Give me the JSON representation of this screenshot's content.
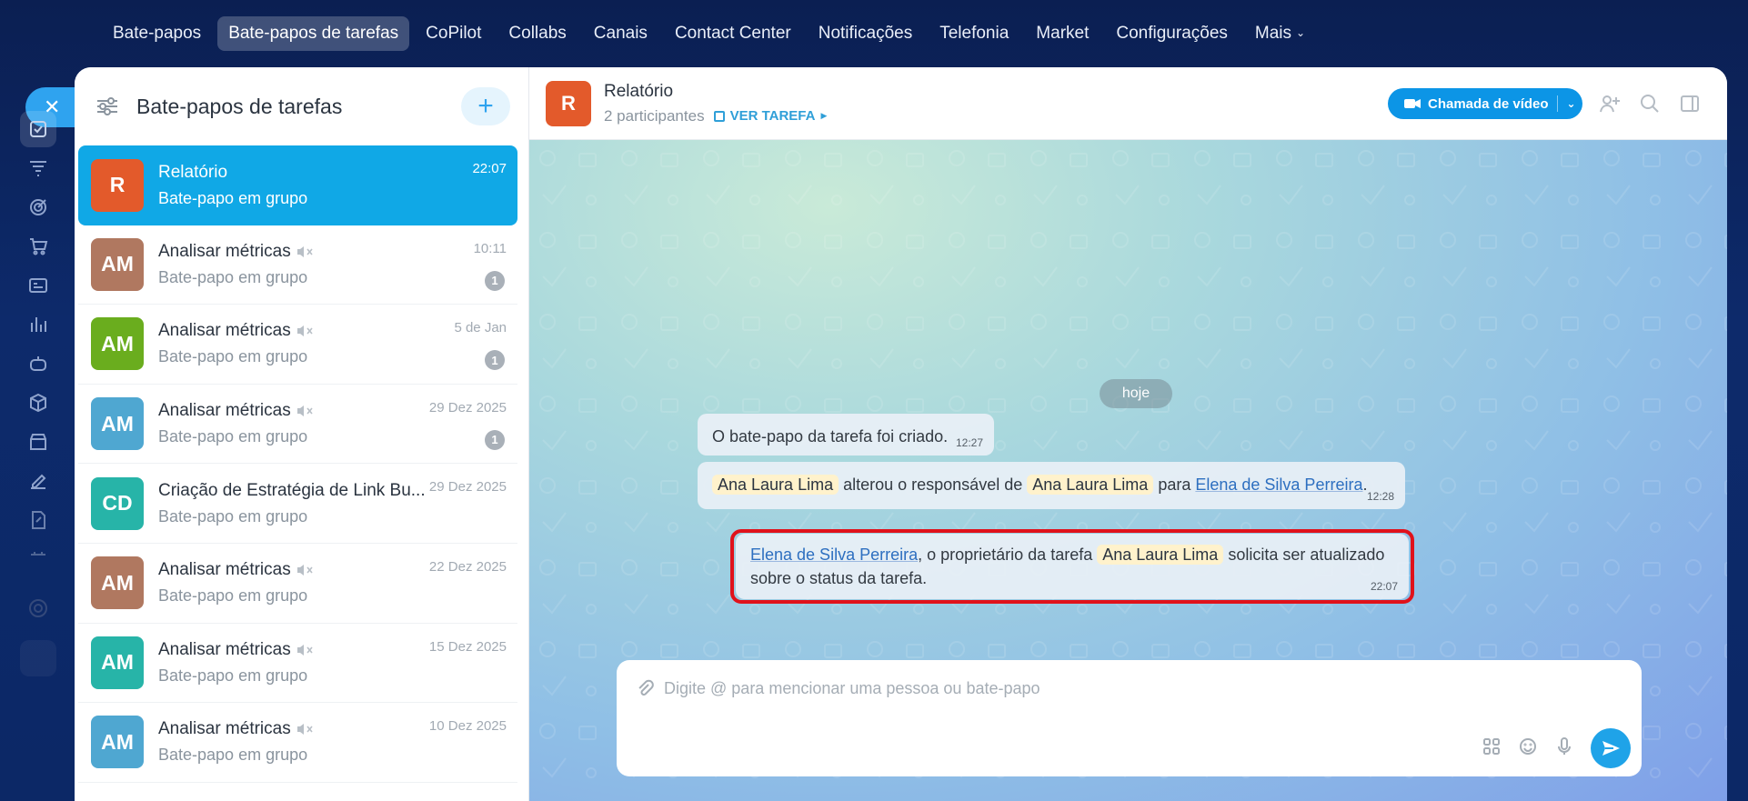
{
  "topnav": {
    "items": [
      "Bate-papos",
      "Bate-papos de tarefas",
      "CoPilot",
      "Collabs",
      "Canais",
      "Contact Center",
      "Notificações",
      "Telefonia",
      "Market",
      "Configurações",
      "Mais"
    ],
    "active_index": 1
  },
  "sidebar": {
    "title": "Bate-papos de tarefas",
    "add_label": "+",
    "chats": [
      {
        "initials": "R",
        "title": "Relatório",
        "sub": "Bate-papo em grupo",
        "time": "22:07",
        "color": "#e35a2b"
      },
      {
        "initials": "AM",
        "title": "Analisar métricas",
        "sub": "Bate-papo em grupo",
        "time": "10:11",
        "badge": "1",
        "color": "#b07860"
      },
      {
        "initials": "AM",
        "title": "Analisar métricas",
        "sub": "Bate-papo em grupo",
        "time": "5 de Jan",
        "badge": "1",
        "color": "#6aad1e"
      },
      {
        "initials": "AM",
        "title": "Analisar métricas",
        "sub": "Bate-papo em grupo",
        "time": "29 Dez 2025",
        "badge": "1",
        "color": "#4fa7d1"
      },
      {
        "initials": "CD",
        "title": "Criação de Estratégia de Link Bu...",
        "sub": "Bate-papo em grupo",
        "time": "29 Dez 2025",
        "color": "#27b4a8"
      },
      {
        "initials": "AM",
        "title": "Analisar métricas",
        "sub": "Bate-papo em grupo",
        "time": "22 Dez 2025",
        "color": "#b07860"
      },
      {
        "initials": "AM",
        "title": "Analisar métricas",
        "sub": "Bate-papo em grupo",
        "time": "15 Dez 2025",
        "color": "#27b4a8"
      },
      {
        "initials": "AM",
        "title": "Analisar métricas",
        "sub": "Bate-papo em grupo",
        "time": "10 Dez 2025",
        "color": "#4fa7d1"
      }
    ]
  },
  "chat": {
    "title": "Relatório",
    "avatar": "R",
    "participants": "2 participantes",
    "task_link": "VER TAREFA",
    "video_call": "Chamada de vídeo",
    "date_separator": "hoje",
    "messages": [
      {
        "text": "O bate-papo da tarefa foi criado.",
        "time": "12:27"
      },
      {
        "name1": "Ana Laura Lima",
        "mid1": " alterou o responsável de ",
        "name2": "Ana Laura Lima",
        "mid2": " para ",
        "name3": "Elena de Silva Perreira",
        "end": ".",
        "time": "12:28"
      },
      {
        "name1": "Elena de Silva Perreira",
        "mid1": ", o proprietário da tarefa ",
        "name2": "Ana Laura Lima",
        "mid2": " solicita ser atualizado sobre o status da tarefa.",
        "time": "22:07"
      }
    ],
    "composer_placeholder": "Digite @ para mencionar uma pessoa ou bate-papo"
  },
  "colors": {
    "accent": "#10a8e6",
    "highlight_border": "#e0121b"
  }
}
